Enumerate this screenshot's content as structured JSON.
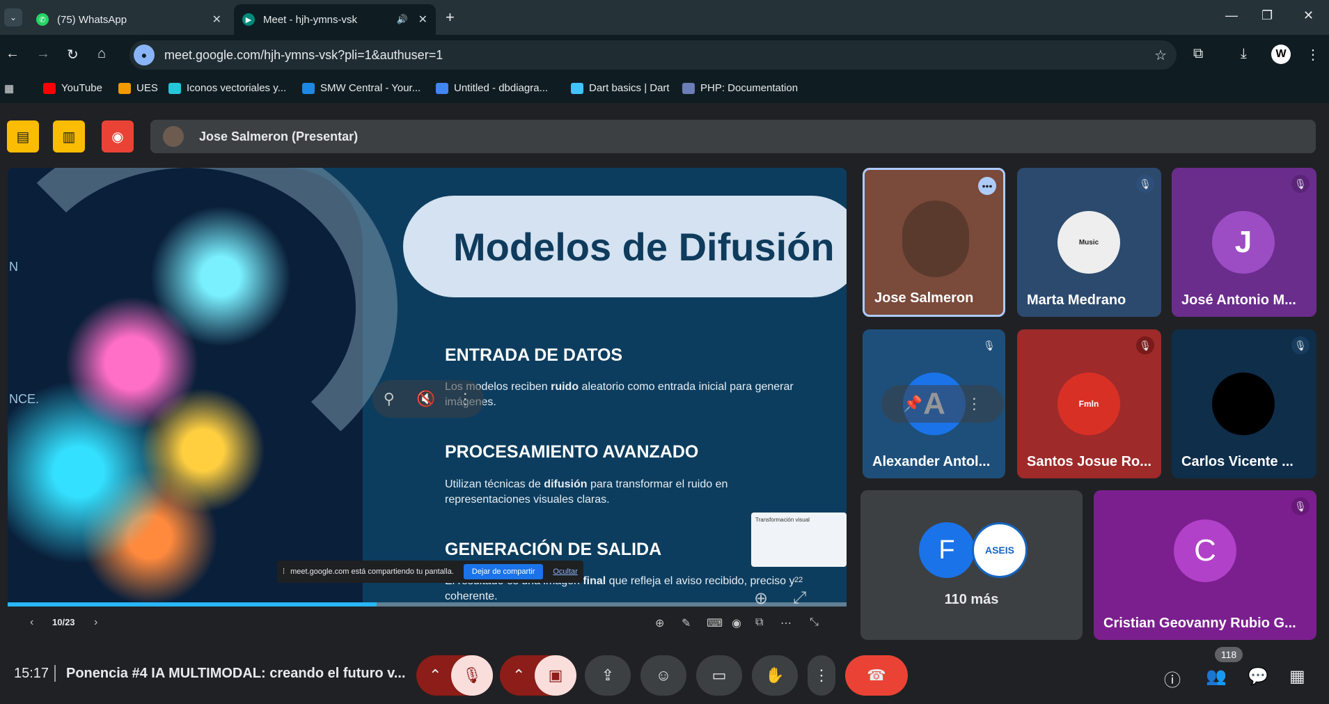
{
  "browser": {
    "tabs": [
      {
        "title": "(75) WhatsApp",
        "icon": "whatsapp-icon"
      },
      {
        "title": "Meet - hjh-ymns-vsk",
        "icon": "meet-icon"
      }
    ],
    "url": "meet.google.com/hjh-ymns-vsk?pli=1&authuser=1",
    "profile_initial": "W",
    "bookmarks": [
      {
        "label": "YouTube",
        "color": "#ff0000"
      },
      {
        "label": "UES",
        "color": "#f29900"
      },
      {
        "label": "Iconos vectoriales y...",
        "color": "#26c6da"
      },
      {
        "label": "SMW Central - Your...",
        "color": "#1e88e5"
      },
      {
        "label": "Untitled - dbdiagra...",
        "color": "#4285f4"
      },
      {
        "label": "Dart basics | Dart",
        "color": "#40c4ff"
      },
      {
        "label": "PHP: Documentation",
        "color": "#6c7eb7"
      }
    ]
  },
  "meet": {
    "presenter_label": "Jose Salmeron (Presentar)",
    "slide": {
      "title": "Modelos de Difusión",
      "left_text_1": "N",
      "left_text_2": "NCE.",
      "sections": [
        {
          "heading": "ENTRADA DE DATOS",
          "body_pre": "Los modelos reciben ",
          "body_bold": "ruido",
          "body_post": " aleatorio como entrada inicial para generar imágenes."
        },
        {
          "heading": "PROCESAMIENTO AVANZADO",
          "body_pre": "Utilizan técnicas de ",
          "body_bold": "difusión",
          "body_post": " para transformar el ruido en representaciones visuales claras."
        },
        {
          "heading": "GENERACIÓN DE SALIDA",
          "body_pre": "El resultado es una imagen ",
          "body_bold": "final",
          "body_post": " que refleja el aviso recibido, preciso y coherente."
        }
      ],
      "thumb_title": "Transformación visual",
      "page": "10/23",
      "progress": 0.44,
      "count": "22"
    },
    "share_notice": {
      "text": "meet.google.com está compartiendo tu pantalla.",
      "stop": "Dejar de compartir",
      "hide": "Ocultar"
    },
    "participants": [
      {
        "name": "Jose Salmeron"
      },
      {
        "name": "Marta Medrano",
        "avatar_text": "Music"
      },
      {
        "name": "José Antonio M...",
        "initial": "J"
      },
      {
        "name": "Alexander Antol...",
        "initial": "A"
      },
      {
        "name": "Santos Josue Ro...",
        "avatar_text": "Fmln"
      },
      {
        "name": "Carlos Vicente ..."
      },
      {
        "name": "Cristian Geovanny Rubio G...",
        "initial": "C"
      }
    ],
    "more": {
      "initial": "F",
      "logo_text": "ASEIS",
      "label": "110 más"
    },
    "bottom": {
      "time": "15:17",
      "title": "Ponencia #4 IA MULTIMODAL: creando el futuro v...",
      "people_count": "118"
    }
  }
}
